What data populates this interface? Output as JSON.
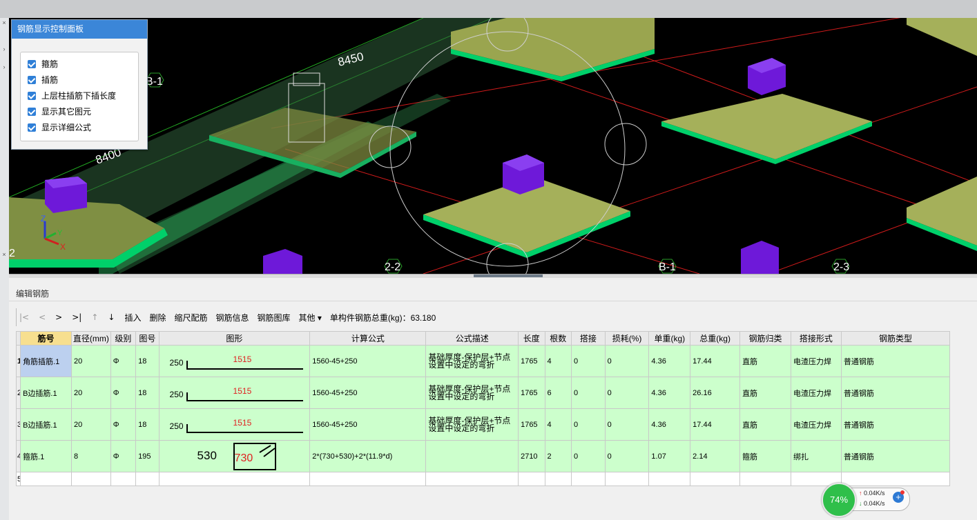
{
  "viewport": {
    "labels": [
      "8450",
      "8400",
      "B-1",
      "2-2",
      "B-1",
      "2-3",
      "2"
    ],
    "axis": {
      "z": "Z",
      "y": "Y",
      "x": "X"
    }
  },
  "panel": {
    "title": "钢筋显示控制面板",
    "options": [
      {
        "label": "箍筋",
        "checked": true
      },
      {
        "label": "插筋",
        "checked": true
      },
      {
        "label": "上层柱插筋下插长度",
        "checked": true
      },
      {
        "label": "显示其它图元",
        "checked": true
      },
      {
        "label": "显示详细公式",
        "checked": true
      }
    ]
  },
  "editor": {
    "title": "编辑钢筋",
    "toolbar": {
      "nav": [
        "|<",
        "<",
        ">",
        ">|",
        "↑",
        "↓"
      ],
      "actions": [
        "插入",
        "删除",
        "缩尺配筋",
        "钢筋信息",
        "钢筋图库",
        "其他 ▾"
      ],
      "total": "单构件钢筋总重(kg)：63.180"
    },
    "columns": [
      "筋号",
      "直径(mm)",
      "级别",
      "图号",
      "图形",
      "计算公式",
      "公式描述",
      "长度",
      "根数",
      "搭接",
      "损耗(%)",
      "单重(kg)",
      "总重(kg)",
      "钢筋归类",
      "搭接形式",
      "钢筋类型"
    ],
    "rows": [
      {
        "n": "1",
        "name": "角筋插筋.1",
        "dia": "20",
        "grade": "Φ",
        "fig": "18",
        "shape_left": "250",
        "shape_main": "1515",
        "formula": "1560-45+250",
        "desc": "基础厚度-保护层+节点设置中设定的弯折",
        "len": "1765",
        "count": "4",
        "lap": "0",
        "loss": "0",
        "unit": "4.36",
        "total": "17.44",
        "cls": "直筋",
        "lapform": "电渣压力焊",
        "type": "普通钢筋"
      },
      {
        "n": "2",
        "name": "B边插筋.1",
        "dia": "20",
        "grade": "Φ",
        "fig": "18",
        "shape_left": "250",
        "shape_main": "1515",
        "formula": "1560-45+250",
        "desc": "基础厚度-保护层+节点设置中设定的弯折",
        "len": "1765",
        "count": "6",
        "lap": "0",
        "loss": "0",
        "unit": "4.36",
        "total": "26.16",
        "cls": "直筋",
        "lapform": "电渣压力焊",
        "type": "普通钢筋"
      },
      {
        "n": "3",
        "name": "B边插筋.1",
        "dia": "20",
        "grade": "Φ",
        "fig": "18",
        "shape_left": "250",
        "shape_main": "1515",
        "formula": "1560-45+250",
        "desc": "基础厚度-保护层+节点设置中设定的弯折",
        "len": "1765",
        "count": "4",
        "lap": "0",
        "loss": "0",
        "unit": "4.36",
        "total": "17.44",
        "cls": "直筋",
        "lapform": "电渣压力焊",
        "type": "普通钢筋"
      },
      {
        "n": "4",
        "name": "箍筋.1",
        "dia": "8",
        "grade": "Φ",
        "fig": "195",
        "shape_left": "530",
        "shape_main": "730",
        "formula": "2*(730+530)+2*(11.9*d)",
        "desc": "",
        "len": "2710",
        "count": "2",
        "lap": "0",
        "loss": "0",
        "unit": "1.07",
        "total": "2.14",
        "cls": "箍筋",
        "lapform": "绑扎",
        "type": "普通钢筋"
      }
    ],
    "empty_row": "5"
  },
  "net": {
    "percent": "74%",
    "up": "0.04K/s",
    "down": "0.04K/s"
  }
}
